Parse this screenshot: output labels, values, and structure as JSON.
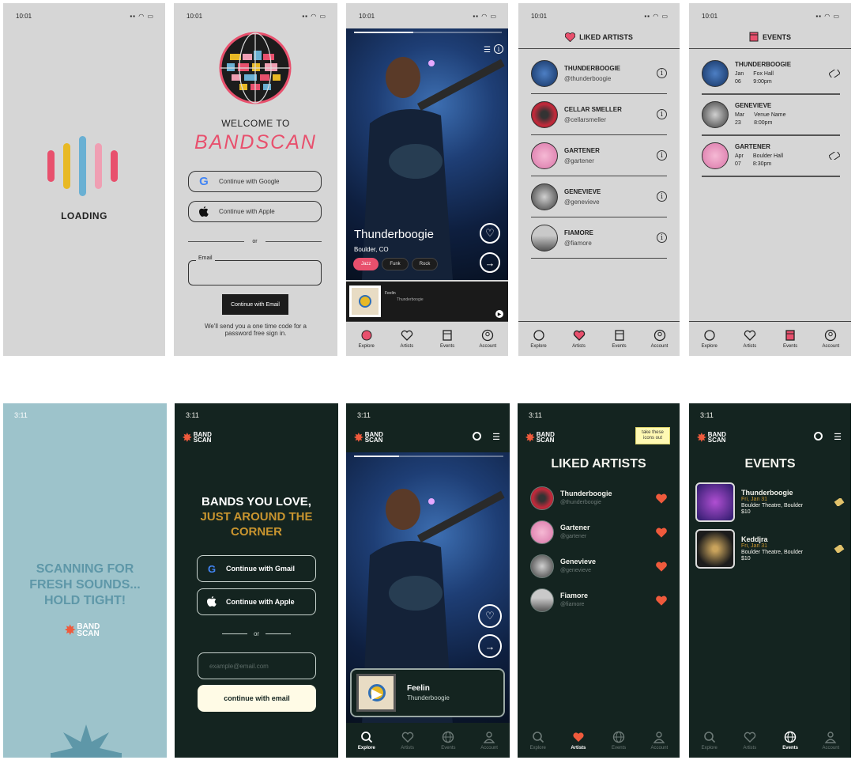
{
  "status_time_gray": "10:01",
  "status_time_dark": "3:11",
  "nav": {
    "explore": "Explore",
    "artists": "Artists",
    "events": "Events",
    "account": "Account"
  },
  "s1": {
    "loading": "LOADING",
    "bar_colors": [
      "#e8506d",
      "#e8b925",
      "#6ab0d3",
      "#ef9fb3",
      "#e8506d"
    ]
  },
  "s2": {
    "welcome": "WELCOME TO",
    "brand": "BANDSCAN",
    "google": "Continue with Google",
    "apple": "Continue with Apple",
    "or": "or",
    "email_label": "Email",
    "email_btn": "Continue with Email",
    "note": "We'll send you a one time code for a password free sign in."
  },
  "s3": {
    "artist": "Thunderboogie",
    "location": "Boulder, CO",
    "tags": [
      "Jazz",
      "Funk",
      "Rock"
    ],
    "song": "Feelin",
    "song_artist": "Thunderboogie"
  },
  "s4": {
    "title": "LIKED ARTISTS",
    "artists": [
      {
        "name": "THUNDERBOOGIE",
        "handle": "@thunderboogie"
      },
      {
        "name": "CELLAR SMELLER",
        "handle": "@cellarsmeller"
      },
      {
        "name": "GARTENER",
        "handle": "@gartener"
      },
      {
        "name": "GENEVIEVE",
        "handle": "@genevieve"
      },
      {
        "name": "FIAMORE",
        "handle": "@fiamore"
      }
    ]
  },
  "s5": {
    "title": "EVENTS",
    "events": [
      {
        "name": "THUNDERBOOGIE",
        "month": "Jan",
        "day": "06",
        "venue": "Fox Hall",
        "time": "9:00pm"
      },
      {
        "name": "GENEVIEVE",
        "month": "Mar",
        "day": "23",
        "venue": "Venue Name",
        "time": "8:00pm"
      },
      {
        "name": "GARTENER",
        "month": "Apr",
        "day": "07",
        "venue": "Boulder Hall",
        "time": "8:30pm"
      }
    ]
  },
  "brand_line1": "BAND",
  "brand_line2": "SCAN",
  "d1": {
    "scan_l1": "SCANNING FOR",
    "scan_l2": "FRESH SOUNDS...",
    "scan_l3": "HOLD TIGHT!"
  },
  "d2": {
    "h1": "BANDS YOU LOVE,",
    "h2": "JUST AROUND THE",
    "h3": "CORNER",
    "gmail": "Continue with Gmail",
    "apple": "Continue with Apple",
    "or": "or",
    "email_placeholder": "example@email.com",
    "email_btn": "continue with email"
  },
  "d3": {
    "song": "Feelin",
    "song_artist": "Thunderboogie"
  },
  "d4": {
    "title": "LIKED ARTISTS",
    "sticky": "take these icons out",
    "artists": [
      {
        "name": "Thunderboogie",
        "handle": "@thunderboogie"
      },
      {
        "name": "Gartener",
        "handle": "@gartener"
      },
      {
        "name": "Genevieve",
        "handle": "@genevieve"
      },
      {
        "name": "Fiamore",
        "handle": "@fiamore"
      }
    ]
  },
  "d5": {
    "title": "EVENTS",
    "events": [
      {
        "name": "Thunderboogie",
        "date": "Fri, Jan 31",
        "venue": "Boulder Theatre, Boulder",
        "price": "$10"
      },
      {
        "name": "Keddjra",
        "date": "Fri, Jan 31",
        "venue": "Boulder Theatre, Boulder",
        "price": "$10"
      }
    ]
  },
  "colors": {
    "accent_red": "#e8506d",
    "dark_bg": "#142420",
    "light_blue_bg": "#9dc3cb",
    "gold": "#c9952f",
    "heart_orange": "#ef5a3c"
  }
}
